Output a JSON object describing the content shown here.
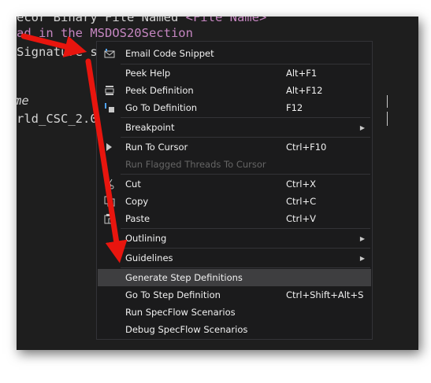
{
  "editor": {
    "line1_prefix": "ecor Binary File Named ",
    "line1_suffix": "<File Name>",
    "line2": "ad in the MSDOS20Section",
    "line3": "Signature s",
    "line4": "me",
    "line5": "rld_CSC_2.0"
  },
  "menu": {
    "email_code_snippet": "Email Code Snippet",
    "peek_help": "Peek Help",
    "peek_help_sc": "Alt+F1",
    "peek_definition": "Peek Definition",
    "peek_definition_sc": "Alt+F12",
    "go_to_definition": "Go To Definition",
    "go_to_definition_sc": "F12",
    "breakpoint": "Breakpoint",
    "run_to_cursor": "Run To Cursor",
    "run_to_cursor_sc": "Ctrl+F10",
    "run_flagged_threads": "Run Flagged Threads To Cursor",
    "cut": "Cut",
    "cut_sc": "Ctrl+X",
    "copy": "Copy",
    "copy_sc": "Ctrl+C",
    "paste": "Paste",
    "paste_sc": "Ctrl+V",
    "outlining": "Outlining",
    "guidelines": "Guidelines",
    "generate_step_definitions": "Generate Step Definitions",
    "go_to_step_definition": "Go To Step Definition",
    "go_to_step_definition_sc": "Ctrl+Shift+Alt+S",
    "run_specflow": "Run SpecFlow Scenarios",
    "debug_specflow": "Debug SpecFlow Scenarios"
  },
  "icons": {
    "email": "email-icon",
    "peek_definition": "peek-definition-icon",
    "go_to_definition": "go-to-definition-icon",
    "run_to_cursor": "run-to-cursor-icon",
    "cut": "cut-icon",
    "copy": "copy-icon",
    "paste": "paste-icon",
    "submenu": "chevron-right-icon"
  },
  "colors": {
    "editor_bg": "#1e1e1e",
    "menu_bg": "#1b1b1c",
    "menu_highlight": "#3e3e40",
    "keyword_purple": "#c586c0",
    "annotation_red": "#e8150e"
  }
}
